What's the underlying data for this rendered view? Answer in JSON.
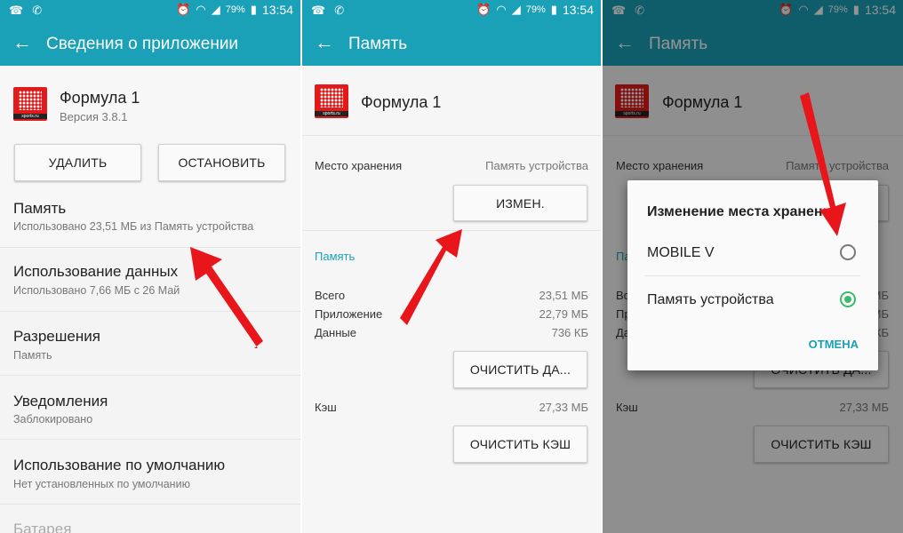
{
  "status": {
    "time": "13:54",
    "battery": "79%"
  },
  "panel1": {
    "title": "Сведения о приложении",
    "app_name": "Формула 1",
    "app_version": "Версия 3.8.1",
    "icon_label": "sports.ru",
    "btn_delete": "УДАЛИТЬ",
    "btn_stop": "ОСТАНОВИТЬ",
    "items": [
      {
        "title": "Память",
        "sub": "Использовано 23,51 МБ из Память устройства"
      },
      {
        "title": "Использование данных",
        "sub": "Использовано 7,66 МБ с 26 Май"
      },
      {
        "title": "Разрешения",
        "sub": "Память"
      },
      {
        "title": "Уведомления",
        "sub": "Заблокировано"
      },
      {
        "title": "Использование по умолчанию",
        "sub": "Нет установленных по умолчанию"
      },
      {
        "title": "Батарея",
        "sub": ""
      }
    ]
  },
  "panel2": {
    "title": "Память",
    "app_name": "Формула 1",
    "storage_label": "Место хранения",
    "storage_value": "Память устройства",
    "btn_change": "ИЗМЕН.",
    "section_memory": "Память",
    "total_label": "Всего",
    "total_value": "23,51 МБ",
    "app_label": "Приложение",
    "app_value": "22,79 МБ",
    "data_label": "Данные",
    "data_value": "736 КБ",
    "btn_clear_data": "ОЧИСТИТЬ ДА...",
    "cache_label": "Кэш",
    "cache_value": "27,33 МБ",
    "btn_clear_cache": "ОЧИСТИТЬ КЭШ"
  },
  "panel3": {
    "dialog_title": "Изменение места хранения",
    "option1": "MOBILE V",
    "option2": "Память устройства",
    "cancel": "ОТМЕНА"
  },
  "colors": {
    "accent": "#1aa1b7",
    "arrow": "#e8161b",
    "radio_on": "#3dbb6c",
    "icon_red": "#e21a1a"
  }
}
